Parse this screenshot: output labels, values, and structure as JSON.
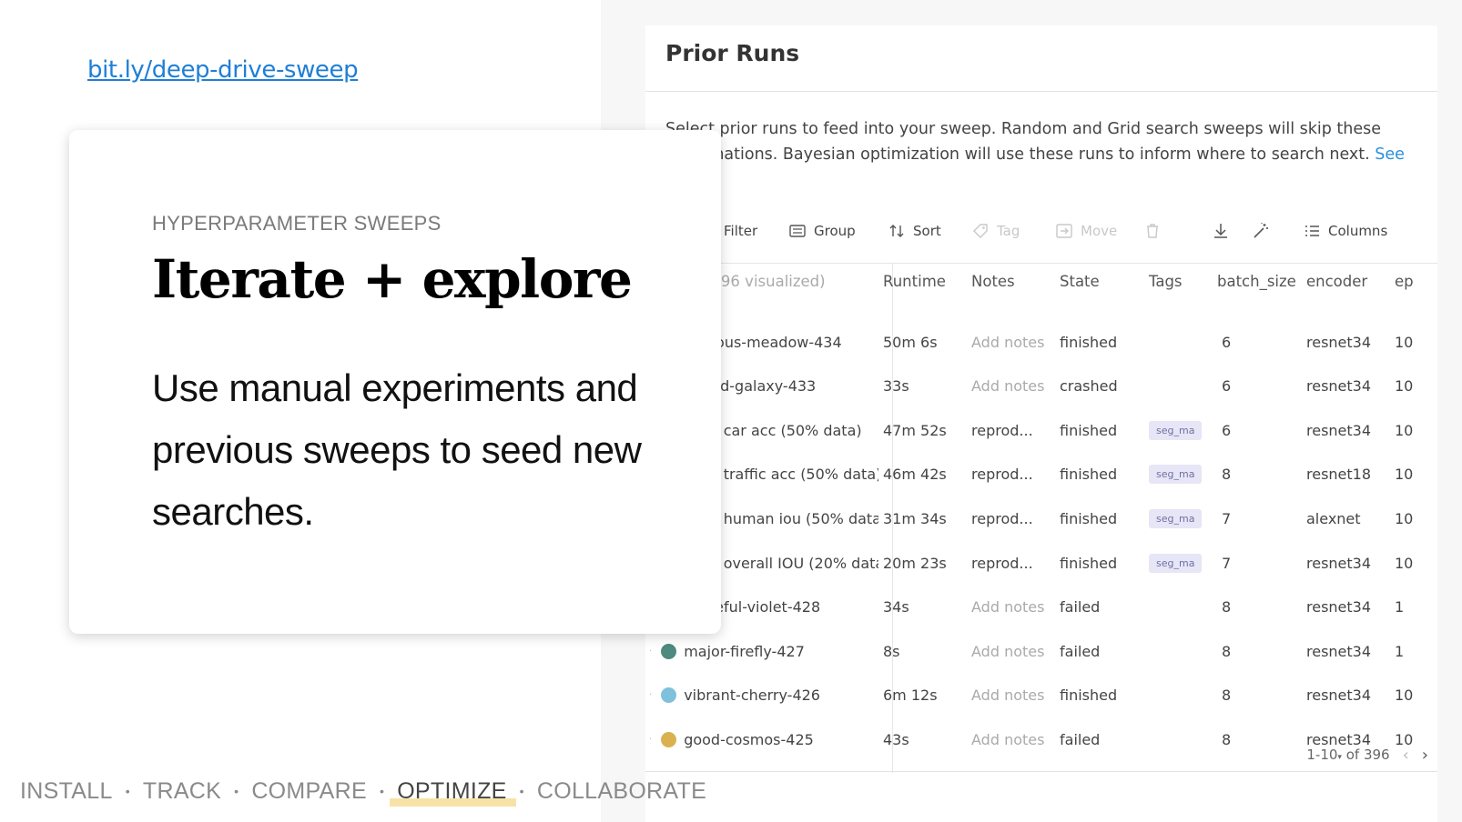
{
  "link": "bit.ly/deep-drive-sweep",
  "card": {
    "eyebrow": "HYPERPARAMETER SWEEPS",
    "headline": "Iterate + explore",
    "body": "Use manual experiments and previous sweeps to seed new searches."
  },
  "panel": {
    "title": "Prior Runs",
    "description": "Select prior runs to feed into your sweep. Random and Grid search sweeps will skip these combinations. Bayesian optimization will use these runs to inform where to search next.",
    "description_link": "See the",
    "toolbar": {
      "filter": "Filter",
      "group": "Group",
      "sort": "Sort",
      "tag": "Tag",
      "move": "Move",
      "columns": "Columns"
    },
    "columns": {
      "name": "(396 visualized)",
      "runtime": "Runtime",
      "notes": "Notes",
      "state": "State",
      "tags": "Tags",
      "batch_size": "batch_size",
      "encoder": "encoder",
      "extra": "ep"
    },
    "rows": [
      {
        "name": "rious-meadow-434",
        "runtime": "50m 6s",
        "notes": "Add notes",
        "state": "finished",
        "tag": "",
        "batch_size": "6",
        "encoder": "resnet34",
        "extra": "10",
        "color": ""
      },
      {
        "name": "ted-galaxy-433",
        "runtime": "33s",
        "notes": "Add notes",
        "state": "crashed",
        "tag": "",
        "batch_size": "6",
        "encoder": "resnet34",
        "extra": "10",
        "color": ""
      },
      {
        "name": "st car acc (50% data)",
        "runtime": "47m 52s",
        "notes": "reprod...",
        "state": "finished",
        "tag": "seg_ma",
        "batch_size": "6",
        "encoder": "resnet34",
        "extra": "10",
        "color": ""
      },
      {
        "name": "st traffic acc (50% data)",
        "runtime": "46m 42s",
        "notes": "reprod...",
        "state": "finished",
        "tag": "seg_ma",
        "batch_size": "8",
        "encoder": "resnet18",
        "extra": "10",
        "color": ""
      },
      {
        "name": "st human iou (50% data",
        "runtime": "31m 34s",
        "notes": "reprod...",
        "state": "finished",
        "tag": "seg_ma",
        "batch_size": "7",
        "encoder": "alexnet",
        "extra": "10",
        "color": ""
      },
      {
        "name": "st overall IOU (20% data",
        "runtime": "20m 23s",
        "notes": "reprod...",
        "state": "finished",
        "tag": "seg_ma",
        "batch_size": "7",
        "encoder": "resnet34",
        "extra": "10",
        "color": ""
      },
      {
        "name": "peful-violet-428",
        "runtime": "34s",
        "notes": "Add notes",
        "state": "failed",
        "tag": "",
        "batch_size": "8",
        "encoder": "resnet34",
        "extra": "1",
        "color": ""
      },
      {
        "name": "major-firefly-427",
        "runtime": "8s",
        "notes": "Add notes",
        "state": "failed",
        "tag": "",
        "batch_size": "8",
        "encoder": "resnet34",
        "extra": "1",
        "color": "#4e8a7e"
      },
      {
        "name": "vibrant-cherry-426",
        "runtime": "6m 12s",
        "notes": "Add notes",
        "state": "finished",
        "tag": "",
        "batch_size": "8",
        "encoder": "resnet34",
        "extra": "10",
        "color": "#7fc0dc"
      },
      {
        "name": "good-cosmos-425",
        "runtime": "43s",
        "notes": "Add notes",
        "state": "failed",
        "tag": "",
        "batch_size": "8",
        "encoder": "resnet34",
        "extra": "10",
        "color": "#d9b24f"
      }
    ],
    "pager": {
      "range": "1-10",
      "of": "of 396"
    }
  },
  "nav": {
    "items": [
      "INSTALL",
      "TRACK",
      "COMPARE",
      "OPTIMIZE",
      "COLLABORATE"
    ],
    "separator": "•",
    "active": "OPTIMIZE"
  }
}
